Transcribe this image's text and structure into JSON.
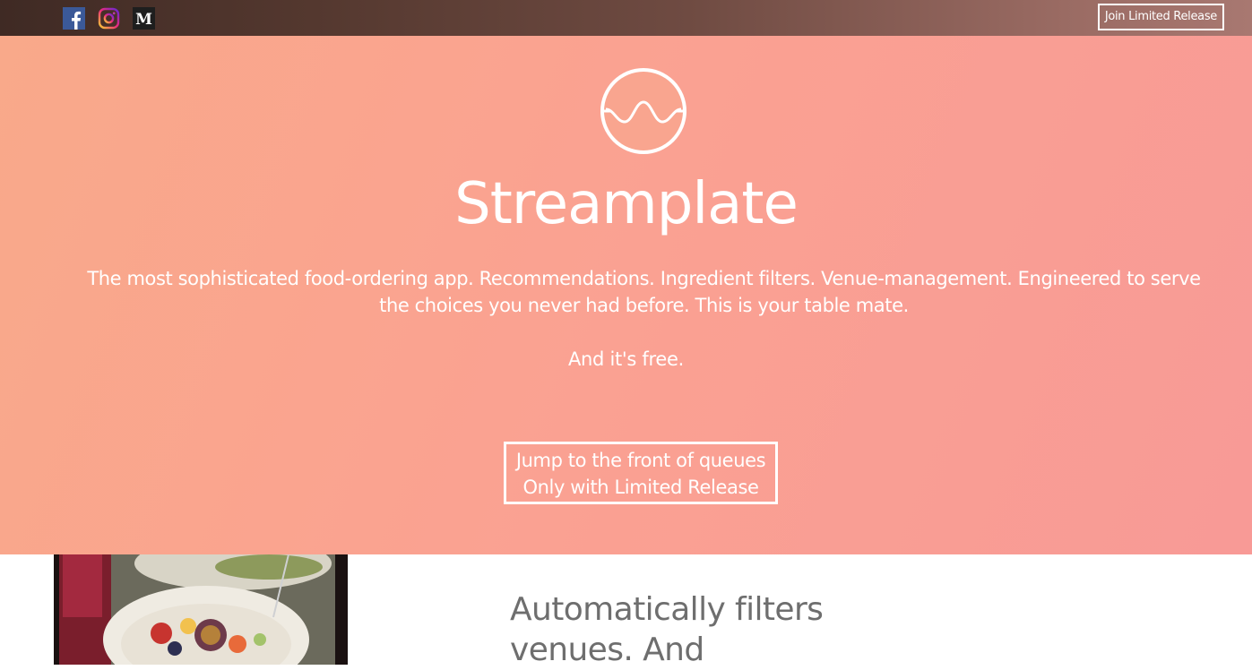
{
  "header": {
    "social_icons": [
      "facebook-icon",
      "instagram-icon",
      "medium-icon"
    ],
    "join_label": "Join Limited Release"
  },
  "hero": {
    "logo_icon": "wave-circle-logo",
    "brand": "Streamplate",
    "tagline": "The most sophisticated food-ordering app. Recommendations. Ingredient filters. Venue-management. Engineered to serve the choices you never had before. This is your table mate.",
    "free_line": "And it's free.",
    "cta_line1": "Jump to the front of queues",
    "cta_line2": "Only with Limited Release"
  },
  "feature": {
    "title_line1": "Automatically filters",
    "title_line2": "venues. And"
  },
  "colors": {
    "hero_start": "#f9a98a",
    "hero_end": "#f89a96",
    "feature_text": "#6e6e6e",
    "facebook": "#3b5998"
  }
}
